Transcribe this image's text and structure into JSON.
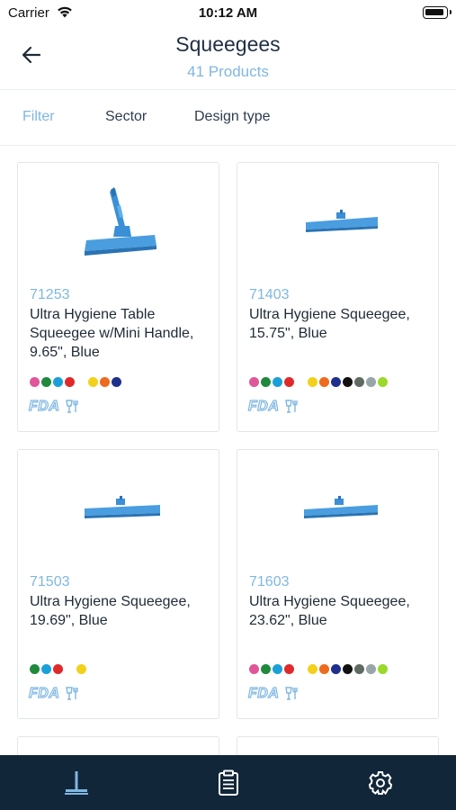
{
  "status_bar": {
    "carrier": "Carrier",
    "time": "10:12 AM"
  },
  "header": {
    "title": "Squeegees",
    "subtitle": "41 Products"
  },
  "filters": [
    {
      "label": "Filter"
    },
    {
      "label": "Sector"
    },
    {
      "label": "Design type"
    }
  ],
  "colors": {
    "accent": "#7fb7e2",
    "product_blue": "#3b8fd6",
    "tab_bar": "#12263a"
  },
  "products": [
    {
      "sku": "71253",
      "name": "Ultra Hygiene Table Squeegee w/Mini Handle, 9.65\", Blue",
      "image_icon": "table-squeegee-with-handle",
      "swatches": [
        "#e0569a",
        "#1f8a3e",
        "#1aa0d8",
        "#e02a2a",
        "",
        "#f2d11b",
        "#ee6a1c",
        "#1e2f8c"
      ],
      "badges": [
        "FDA",
        "food-safe-icon"
      ]
    },
    {
      "sku": "71403",
      "name": "Ultra Hygiene Squeegee, 15.75\", Blue",
      "image_icon": "floor-squeegee",
      "swatches": [
        "#e0569a",
        "#1f8a3e",
        "#1aa0d8",
        "#e02a2a",
        "",
        "#f2d11b",
        "#ee6a1c",
        "#1e2f8c",
        "#111111",
        "#5f6a62",
        "#97a5a8",
        "#9ad82a"
      ],
      "badges": [
        "FDA",
        "food-safe-icon"
      ]
    },
    {
      "sku": "71503",
      "name": "Ultra Hygiene Squeegee, 19.69\", Blue",
      "image_icon": "floor-squeegee",
      "swatches": [
        "#1f8a3e",
        "#1aa0d8",
        "#e02a2a",
        "",
        "#f2d11b"
      ],
      "badges": [
        "FDA",
        "food-safe-icon"
      ]
    },
    {
      "sku": "71603",
      "name": "Ultra Hygiene Squeegee, 23.62\", Blue",
      "image_icon": "floor-squeegee",
      "swatches": [
        "#e0569a",
        "#1f8a3e",
        "#1aa0d8",
        "#e02a2a",
        "",
        "#f2d11b",
        "#ee6a1c",
        "#1e2f8c",
        "#111111",
        "#5f6a62",
        "#97a5a8",
        "#9ad82a"
      ],
      "badges": [
        "FDA",
        "food-safe-icon"
      ]
    }
  ],
  "tab_bar": [
    {
      "icon": "squeegee-icon",
      "active": true
    },
    {
      "icon": "clipboard-icon",
      "active": false
    },
    {
      "icon": "gear-icon",
      "active": false
    }
  ]
}
